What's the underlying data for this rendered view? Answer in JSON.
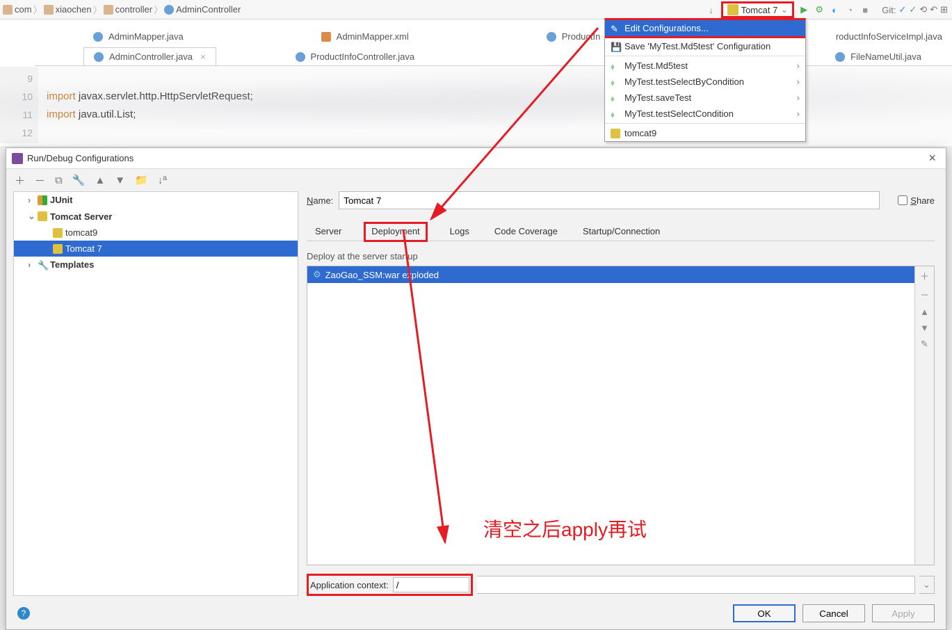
{
  "breadcrumb": {
    "p1": "com",
    "p2": "xiaochen",
    "p3": "controller",
    "p4": "AdminController"
  },
  "runconfig": {
    "selected": "Tomcat 7",
    "git_label": "Git:"
  },
  "menu": {
    "edit": "Edit Configurations...",
    "save": "Save 'MyTest.Md5test' Configuration",
    "i1": "MyTest.Md5test",
    "i2": "MyTest.testSelectByCondition",
    "i3": "MyTest.saveTest",
    "i4": "MyTest.testSelectCondition",
    "i5": "tomcat9"
  },
  "tabs": {
    "t1": "AdminMapper.java",
    "t2": "AdminMapper.xml",
    "t3": "ProductIn",
    "t4": "roductInfoServiceImpl.java",
    "b1": "AdminController.java",
    "b2": "ProductInfoController.java",
    "b3": "FileNameUtil.java"
  },
  "code": {
    "l9n": "9",
    "l10n": "10",
    "l11n": "11",
    "l12n": "12",
    "l10": "import javax.servlet.http.HttpServletRequest;",
    "l11": "import java.util.List;",
    "kw": "import"
  },
  "dialog": {
    "title": "Run/Debug Configurations",
    "name_label": "Name:",
    "name_value": "Tomcat 7",
    "share": "Share",
    "tree": {
      "junit": "JUnit",
      "tomcat_server": "Tomcat Server",
      "tomcat9": "tomcat9",
      "tomcat7": "Tomcat 7",
      "templates": "Templates"
    },
    "tabs": {
      "server": "Server",
      "deployment": "Deployment",
      "logs": "Logs",
      "coverage": "Code Coverage",
      "startup": "Startup/Connection"
    },
    "deploy_label": "Deploy at the server startup",
    "deploy_item": "ZaoGao_SSM:war exploded",
    "appctx_label": "Application context:",
    "appctx_value": "/",
    "ok": "OK",
    "cancel": "Cancel",
    "apply": "Apply"
  },
  "annotation": {
    "text": "清空之后apply再试"
  }
}
